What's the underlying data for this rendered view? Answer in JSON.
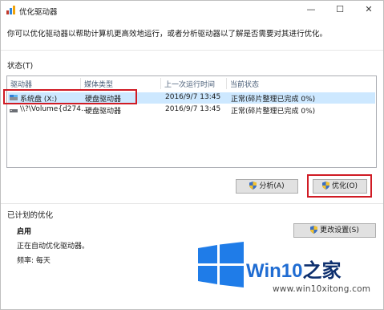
{
  "window": {
    "title": "优化驱动器"
  },
  "controls": {
    "minimize": "—",
    "maximize": "☐",
    "close": "✕"
  },
  "description": "你可以优化驱动器以帮助计算机更高效地运行，或者分析驱动器以了解是否需要对其进行优化。",
  "status_label": "状态(T)",
  "columns": [
    "驱动器",
    "媒体类型",
    "上一次运行时间",
    "当前状态"
  ],
  "drives": [
    {
      "name": "系统盘 (X:)",
      "media": "硬盘驱动器",
      "last_run": "2016/9/7 13:45",
      "status": "正常(碎片整理已完成 0%)"
    },
    {
      "name": "\\\\?\\Volume{d274...",
      "media": "硬盘驱动器",
      "last_run": "2016/9/7 13:45",
      "status": "正常(碎片整理已完成 0%)"
    }
  ],
  "buttons": {
    "analyze": "分析(A)",
    "optimize": "优化(O)",
    "change_settings": "更改设置(S)"
  },
  "scheduled": {
    "label": "已计划的优化",
    "state": "启用",
    "detail": "正在自动优化驱动器。",
    "frequency": "频率: 每天"
  },
  "watermark": {
    "brand_part1": "Win10",
    "brand_part2": "之家",
    "site": "www.win10xitong.com"
  },
  "colors": {
    "accent": "#1f6cd2",
    "highlight": "#d01b24",
    "selection": "#cde8ff"
  }
}
